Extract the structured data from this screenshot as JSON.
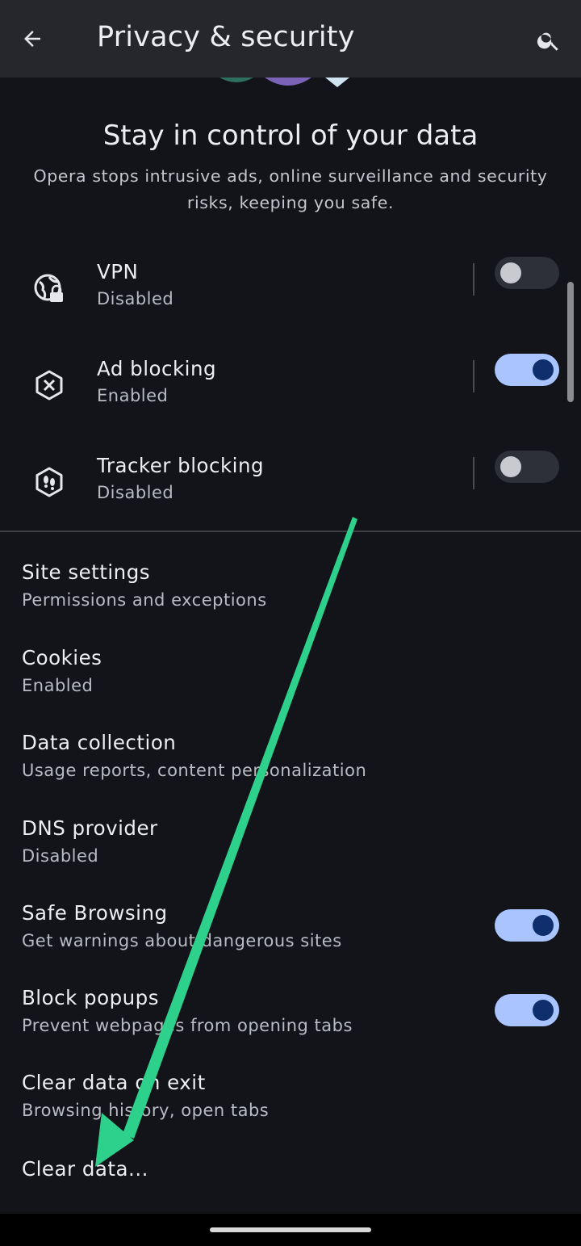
{
  "appbar": {
    "title": "Privacy & security",
    "back_icon": "arrow-back-icon",
    "search_icon": "search-icon"
  },
  "hero": {
    "title": "Stay in control of your data",
    "subtitle": "Opera stops intrusive ads, online surveillance and security risks, keeping you safe."
  },
  "toggles": [
    {
      "label": "VPN",
      "status": "Disabled",
      "icon": "vpn-globe-lock-icon",
      "on": false
    },
    {
      "label": "Ad blocking",
      "status": "Enabled",
      "icon": "ad-block-icon",
      "on": true
    },
    {
      "label": "Tracker blocking",
      "status": "Disabled",
      "icon": "tracker-block-icon",
      "on": false
    }
  ],
  "settings": [
    {
      "label": "Site settings",
      "sub": "Permissions and exceptions"
    },
    {
      "label": "Cookies",
      "sub": "Enabled"
    },
    {
      "label": "Data collection",
      "sub": "Usage reports, content personalization"
    },
    {
      "label": "DNS provider",
      "sub": "Disabled"
    },
    {
      "label": "Safe Browsing",
      "sub": "Get warnings about dangerous sites",
      "on": true
    },
    {
      "label": "Block popups",
      "sub": "Prevent webpages from opening tabs",
      "on": true
    },
    {
      "label": "Clear data on exit",
      "sub": "Browsing history, open tabs"
    },
    {
      "label": "Clear data..."
    }
  ],
  "colors": {
    "background": "#12141a",
    "appbar": "#25272c",
    "switch_on_track": "#a9c4ff",
    "switch_on_knob": "#0e2f6c",
    "annotation_arrow": "#2ed18c"
  }
}
